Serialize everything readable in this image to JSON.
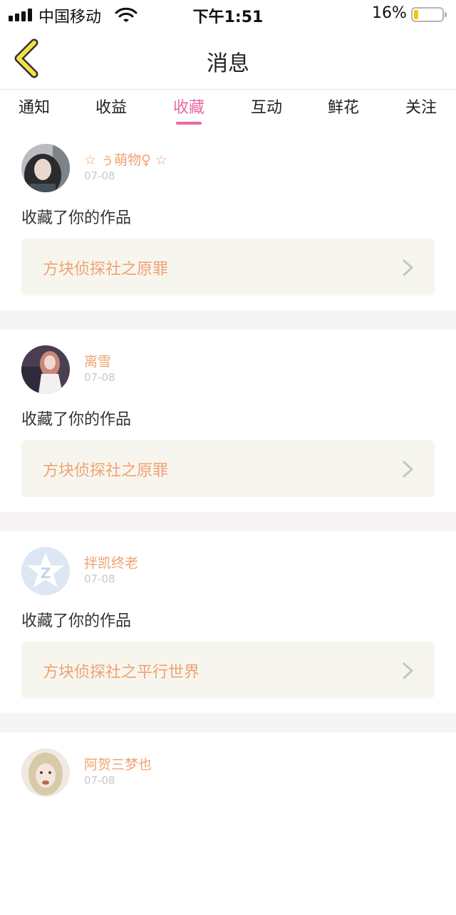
{
  "status_bar": {
    "carrier": "中国移动",
    "time": "下午1:51",
    "battery": "16%",
    "battery_level": 0.16
  },
  "header": {
    "title": "消息"
  },
  "tabs": [
    {
      "label": "通知",
      "active": false
    },
    {
      "label": "收益",
      "active": false
    },
    {
      "label": "收藏",
      "active": true
    },
    {
      "label": "互动",
      "active": false
    },
    {
      "label": "鲜花",
      "active": false
    },
    {
      "label": "关注",
      "active": false
    }
  ],
  "colors": {
    "accent": "#e66aa3",
    "username": "#f0a272",
    "card_bg": "#f7f6ee",
    "back_arrow": "#f2e14a"
  },
  "feed": [
    {
      "username": "☆ ぅ萌物♀ ☆",
      "date": "07-08",
      "action": "收藏了你的作品",
      "work": "方块侦探社之原罪",
      "avatar": "photo-avatar-dark-hair"
    },
    {
      "username": "离雪",
      "date": "07-08",
      "action": "收藏了你的作品",
      "work": "方块侦探社之原罪",
      "avatar": "photo-avatar-pink-hair"
    },
    {
      "username": "拌凯终老",
      "date": "07-08",
      "action": "收藏了你的作品",
      "work": "方块侦探社之平行世界",
      "avatar": "default-star-avatar"
    },
    {
      "username": "阿贺三梦也",
      "date": "07-08",
      "action": "",
      "work": "",
      "avatar": "photo-avatar-blonde-doll"
    }
  ]
}
